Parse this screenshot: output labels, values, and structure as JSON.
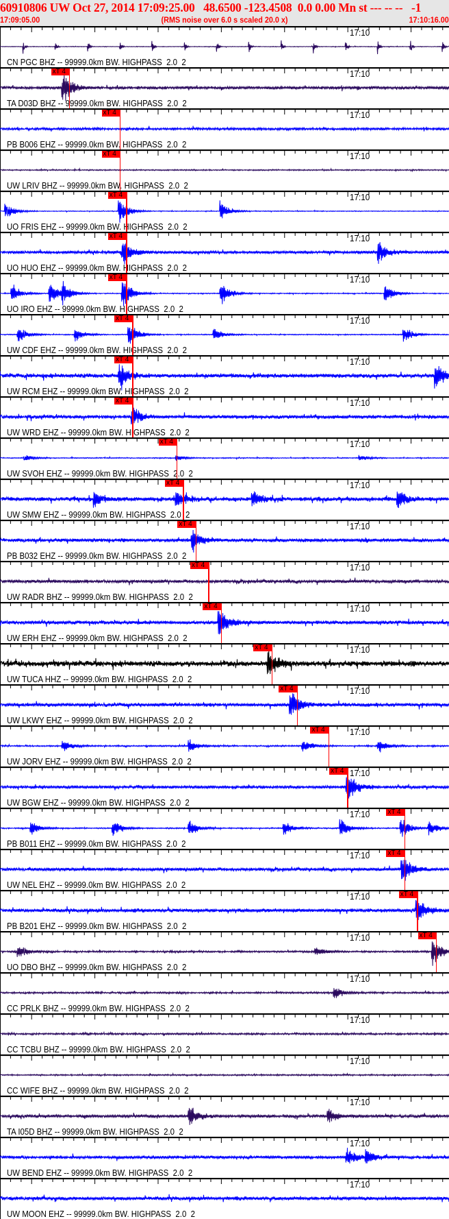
{
  "header": {
    "title": "60910806 UW Oct 27, 2014 17:09:25.00   48.6500 -123.4508  0.0 0.00 Mn st --- -- --   -1",
    "start_time": "17:09:05.00",
    "rms_note": "(RMS noise over 6.0 s scaled 20.0 x)",
    "end_time": "17:10:16.00"
  },
  "axis": {
    "span_s": 71,
    "minute_label": "17:10",
    "minute_offset_s": 55
  },
  "pick_label": "xT 4",
  "colors": {
    "blue": "#0000ff",
    "purple": "#2b0a5e",
    "black": "#000000",
    "pick": "#ff0000"
  },
  "traces": [
    {
      "label": "CN PGC BHZ -- 99999.0km BW. HIGHPASS  2.0  2",
      "color": "purple",
      "noise": 0.05,
      "periodic": 5.1,
      "bursts": [],
      "pick": null
    },
    {
      "label": "TA D03D BHZ -- 99999.0km BW. HIGHPASS  2.0  2",
      "color": "purple",
      "noise": 0.25,
      "bursts": [
        [
          10,
          1.0
        ]
      ],
      "pick": 11.0
    },
    {
      "label": "PB B006 EHZ -- 99999.0km BW. HIGHPASS  2.0  2",
      "color": "blue",
      "noise": 0.2,
      "bursts": [],
      "pick": 19.0
    },
    {
      "label": "UW LRIV BHZ -- 99999.0km BW. HIGHPASS  2.0  2",
      "color": "purple",
      "noise": 0.1,
      "bursts": [],
      "pick": 19.0
    },
    {
      "label": "UO FRIS EHZ -- 99999.0km BW. HIGHPASS  2.0  2",
      "color": "blue",
      "noise": 0.06,
      "bursts": [
        [
          1,
          0.5
        ],
        [
          19,
          0.8
        ],
        [
          35,
          0.6
        ]
      ],
      "pick": 20.0
    },
    {
      "label": "UO HUO EHZ -- 99999.0km BW. HIGHPASS  2.0  2",
      "color": "blue",
      "noise": 0.25,
      "bursts": [
        [
          19.5,
          1.0
        ],
        [
          60,
          0.7
        ]
      ],
      "pick": 20.0
    },
    {
      "label": "UO IRO EHZ -- 99999.0km BW. HIGHPASS  2.0  2",
      "color": "blue",
      "noise": 0.08,
      "bursts": [
        [
          2,
          0.6
        ],
        [
          8,
          0.7
        ],
        [
          10,
          0.6
        ],
        [
          19.5,
          1.0
        ],
        [
          35,
          0.7
        ],
        [
          61,
          0.6
        ]
      ],
      "pick": 20.0
    },
    {
      "label": "UW CDF EHZ -- 99999.0km BW. HIGHPASS  2.0  2",
      "color": "blue",
      "noise": 0.08,
      "bursts": [
        [
          3,
          0.5
        ],
        [
          12,
          0.4
        ],
        [
          20.5,
          0.8
        ],
        [
          34,
          0.4
        ],
        [
          64,
          0.5
        ]
      ],
      "pick": 21.0
    },
    {
      "label": "UW RCM EHZ -- 99999.0km BW. HIGHPASS  2.0  2",
      "color": "blue",
      "noise": 0.35,
      "bursts": [
        [
          19,
          0.8
        ],
        [
          69,
          0.9
        ]
      ],
      "pick": 21.0
    },
    {
      "label": "UW WRD EHZ -- 99999.0km BW. HIGHPASS  2.0  2",
      "color": "blue",
      "noise": 0.3,
      "bursts": [
        [
          21,
          0.6
        ]
      ],
      "pick": 21.0
    },
    {
      "label": "UW SVOH EHZ -- 99999.0km BW. HIGHPASS  2.0  2",
      "color": "blue",
      "noise": 0.08,
      "bursts": [
        [
          4,
          0.2
        ],
        [
          28,
          0.2
        ],
        [
          57,
          0.2
        ]
      ],
      "pick": 28.0
    },
    {
      "label": "UW SMW EHZ -- 99999.0km BW. HIGHPASS  2.0  2",
      "color": "blue",
      "noise": 0.35,
      "bursts": [
        [
          15,
          0.5
        ],
        [
          28,
          0.5
        ],
        [
          40,
          0.5
        ],
        [
          63,
          0.6
        ]
      ],
      "pick": 29.0
    },
    {
      "label": "PB B032 EHZ -- 99999.0km BW. HIGHPASS  2.0  2",
      "color": "blue",
      "noise": 0.3,
      "bursts": [
        [
          30.5,
          0.8
        ]
      ],
      "pick": 31.0
    },
    {
      "label": "UW RADR BHZ -- 99999.0km BW. HIGHPASS  2.0  2",
      "color": "purple",
      "noise": 0.25,
      "bursts": [],
      "pick": 33.0
    },
    {
      "label": "UW ERH EHZ -- 99999.0km BW. HIGHPASS  2.0  2",
      "color": "blue",
      "noise": 0.3,
      "bursts": [
        [
          34.7,
          1.0
        ]
      ],
      "pick": 35.0
    },
    {
      "label": "UW TUCA HHZ -- 99999.0km BW. HIGHPASS  2.0  2",
      "color": "black",
      "noise": 0.45,
      "bursts": [
        [
          42.5,
          0.9
        ]
      ],
      "pick": 43.0
    },
    {
      "label": "UW LKWY EHZ -- 99999.0km BW. HIGHPASS  2.0  2",
      "color": "blue",
      "noise": 0.3,
      "bursts": [
        [
          46,
          1.0
        ]
      ],
      "pick": 47.0
    },
    {
      "label": "UW JORV EHZ -- 99999.0km BW. HIGHPASS  2.0  2",
      "color": "blue",
      "noise": 0.12,
      "bursts": [
        [
          10,
          0.4
        ],
        [
          30,
          0.4
        ],
        [
          48,
          0.4
        ],
        [
          60,
          0.4
        ]
      ],
      "pick": 52.0
    },
    {
      "label": "UW BGW EHZ -- 99999.0km BW. HIGHPASS  2.0  2",
      "color": "blue",
      "noise": 0.25,
      "bursts": [
        [
          55,
          1.0
        ]
      ],
      "pick": 55.0
    },
    {
      "label": "PB B011 EHZ -- 99999.0km BW. HIGHPASS  2.0  2",
      "color": "blue",
      "noise": 0.1,
      "bursts": [
        [
          5,
          0.5
        ],
        [
          18,
          0.5
        ],
        [
          30,
          0.5
        ],
        [
          45,
          0.5
        ],
        [
          54,
          0.6
        ],
        [
          63.5,
          0.7
        ],
        [
          68,
          0.5
        ]
      ],
      "pick": 64.0
    },
    {
      "label": "UW NEL EHZ -- 99999.0km BW. HIGHPASS  2.0  2",
      "color": "blue",
      "noise": 0.25,
      "bursts": [
        [
          63.7,
          1.0
        ]
      ],
      "pick": 64.0
    },
    {
      "label": "PB B201 EHZ -- 99999.0km BW. HIGHPASS  2.0  2",
      "color": "blue",
      "noise": 0.3,
      "bursts": [
        [
          66,
          0.8
        ]
      ],
      "pick": 66.0
    },
    {
      "label": "UO DBO BHZ -- 99999.0km BW. HIGHPASS  2.0  2",
      "color": "purple",
      "noise": 0.15,
      "bursts": [
        [
          3,
          0.4
        ],
        [
          50,
          0.3
        ],
        [
          68.5,
          1.0
        ]
      ],
      "pick": 69.0
    },
    {
      "label": "CC PRLK BHZ -- 99999.0km BW. HIGHPASS  2.0  2",
      "color": "purple",
      "noise": 0.15,
      "bursts": [
        [
          53,
          0.3
        ]
      ],
      "pick": null
    },
    {
      "label": "CC TCBU BHZ -- 99999.0km BW. HIGHPASS  2.0  2",
      "color": "purple",
      "noise": 0.15,
      "bursts": [],
      "pick": null
    },
    {
      "label": "CC WIFE BHZ -- 99999.0km BW. HIGHPASS  2.0  2",
      "color": "purple",
      "noise": 0.12,
      "bursts": [],
      "pick": null
    },
    {
      "label": "TA I05D BHZ -- 99999.0km BW. HIGHPASS  2.0  2",
      "color": "purple",
      "noise": 0.25,
      "bursts": [
        [
          30,
          0.6
        ],
        [
          52,
          0.5
        ]
      ],
      "pick": null
    },
    {
      "label": "UW BEND EHZ -- 99999.0km BW. HIGHPASS  2.0  2",
      "color": "blue",
      "noise": 0.25,
      "bursts": [
        [
          55,
          0.6
        ],
        [
          58,
          0.5
        ]
      ],
      "pick": null
    },
    {
      "label": "UW MOON EHZ -- 99999.0km BW. HIGHPASS  2.0  2",
      "color": "blue",
      "noise": 0.3,
      "bursts": [],
      "pick": null
    }
  ]
}
